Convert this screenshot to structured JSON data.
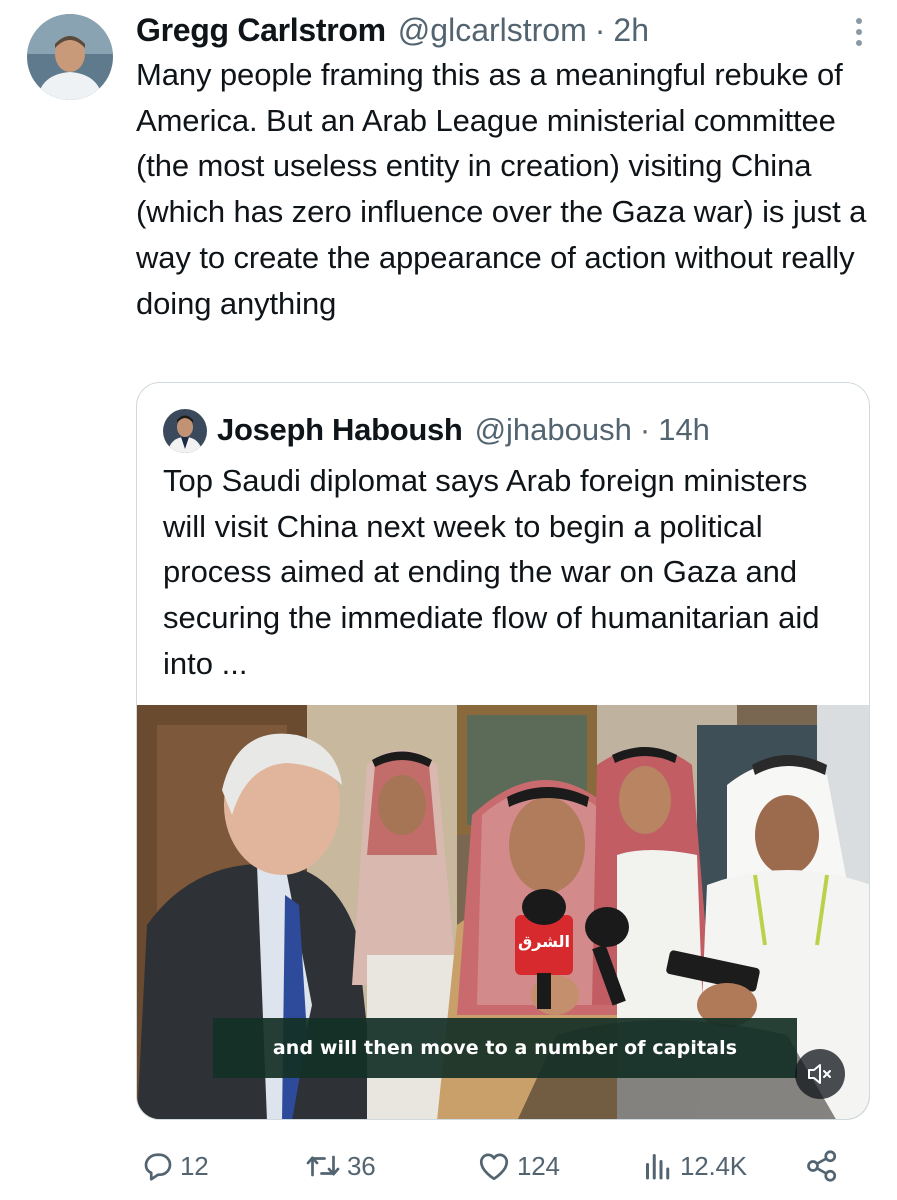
{
  "tweet": {
    "author": {
      "display_name": "Gregg Carlstrom",
      "handle": "@glcarlstrom",
      "separator": "·",
      "time": "2h"
    },
    "text": "Many people framing this as a meaningful rebuke of America. But an Arab League ministerial committee (the most useless entity in creation) visiting China (which has zero influence over the Gaza war) is just a way to create the appearance of action without really doing anything",
    "more_icon": "more-vertical-icon"
  },
  "quote": {
    "author": {
      "display_name": "Joseph Haboush",
      "handle": "@jhaboush",
      "separator": "·",
      "time": "14h"
    },
    "text": "Top Saudi diplomat says Arab foreign ministers will visit China next week to begin a political process aimed at ending the war on Gaza and securing the immediate flow of humanitarian aid into ...",
    "media": {
      "subtitle": "and will then move to a number of capitals",
      "mic_logo_text": "الشرق",
      "mute_icon": "volume-muted-icon"
    }
  },
  "actions": {
    "reply": {
      "icon": "reply-icon",
      "count": "12"
    },
    "retweet": {
      "icon": "retweet-icon",
      "count": "36"
    },
    "like": {
      "icon": "heart-icon",
      "count": "124"
    },
    "views": {
      "icon": "views-chart-icon",
      "count": "12.4K"
    },
    "share": {
      "icon": "share-icon"
    }
  },
  "colors": {
    "text_primary": "#0f1419",
    "text_secondary": "#536471",
    "border": "#cfd9de",
    "subtitle_bg": "#14302a"
  }
}
